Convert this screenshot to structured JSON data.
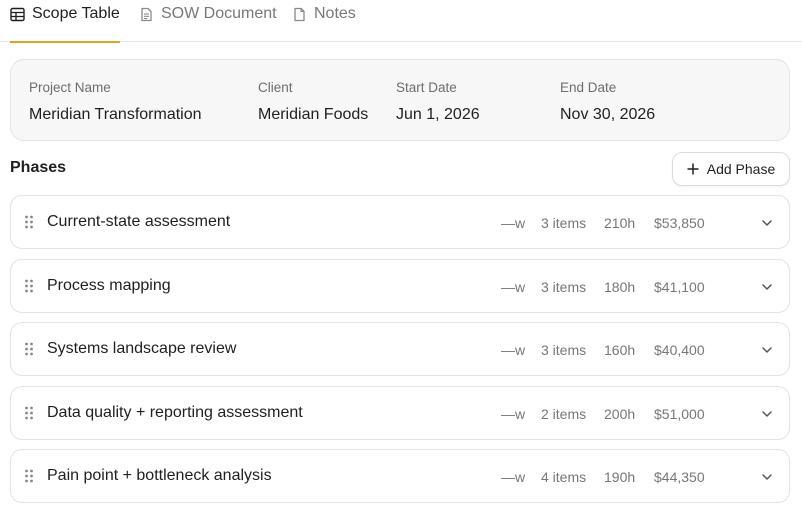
{
  "tabs": [
    {
      "label": "Scope Table",
      "icon": "table-icon",
      "active": true
    },
    {
      "label": "SOW Document",
      "icon": "document-icon",
      "active": false
    },
    {
      "label": "Notes",
      "icon": "note-icon",
      "active": false
    }
  ],
  "project": {
    "fields": [
      {
        "label": "Project Name",
        "value": "Meridian Transformation"
      },
      {
        "label": "Client",
        "value": "Meridian Foods"
      },
      {
        "label": "Start Date",
        "value": "Jun 1, 2026"
      },
      {
        "label": "End Date",
        "value": "Nov 30, 2026"
      }
    ]
  },
  "phases": {
    "title": "Phases",
    "add_label": "Add Phase",
    "rows": [
      {
        "name": "Current-state assessment",
        "weeks": "—w",
        "items": "3 items",
        "hours": "210h",
        "cost": "$53,850"
      },
      {
        "name": "Process mapping",
        "weeks": "—w",
        "items": "3 items",
        "hours": "180h",
        "cost": "$41,100"
      },
      {
        "name": "Systems landscape review",
        "weeks": "—w",
        "items": "3 items",
        "hours": "160h",
        "cost": "$40,400"
      },
      {
        "name": "Data quality + reporting assessment",
        "weeks": "—w",
        "items": "2 items",
        "hours": "200h",
        "cost": "$51,000"
      },
      {
        "name": "Pain point + bottleneck analysis",
        "weeks": "—w",
        "items": "4 items",
        "hours": "190h",
        "cost": "$44,350"
      }
    ]
  },
  "colors": {
    "accent": "#e0a21a",
    "border": "#e3e3e3",
    "muted": "#777777"
  }
}
